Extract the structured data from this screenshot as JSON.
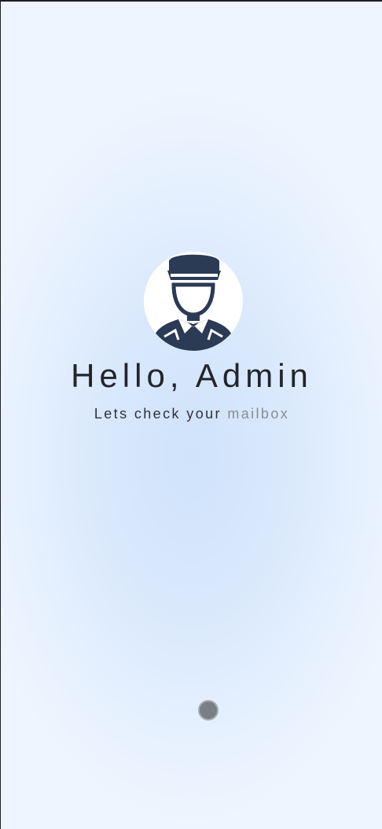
{
  "greeting": {
    "text": "Hello, Admin"
  },
  "subtitle": {
    "text_main": "Lets check your ",
    "text_faded": "mailbox"
  },
  "avatar": {
    "icon": "user-officer-icon",
    "bg_color": "#ffffff",
    "figure_color": "#2b3a55"
  },
  "colors": {
    "background_center": "#cfe3fb",
    "background_edge": "#eef5fe",
    "indicator": "#7a7e86"
  }
}
